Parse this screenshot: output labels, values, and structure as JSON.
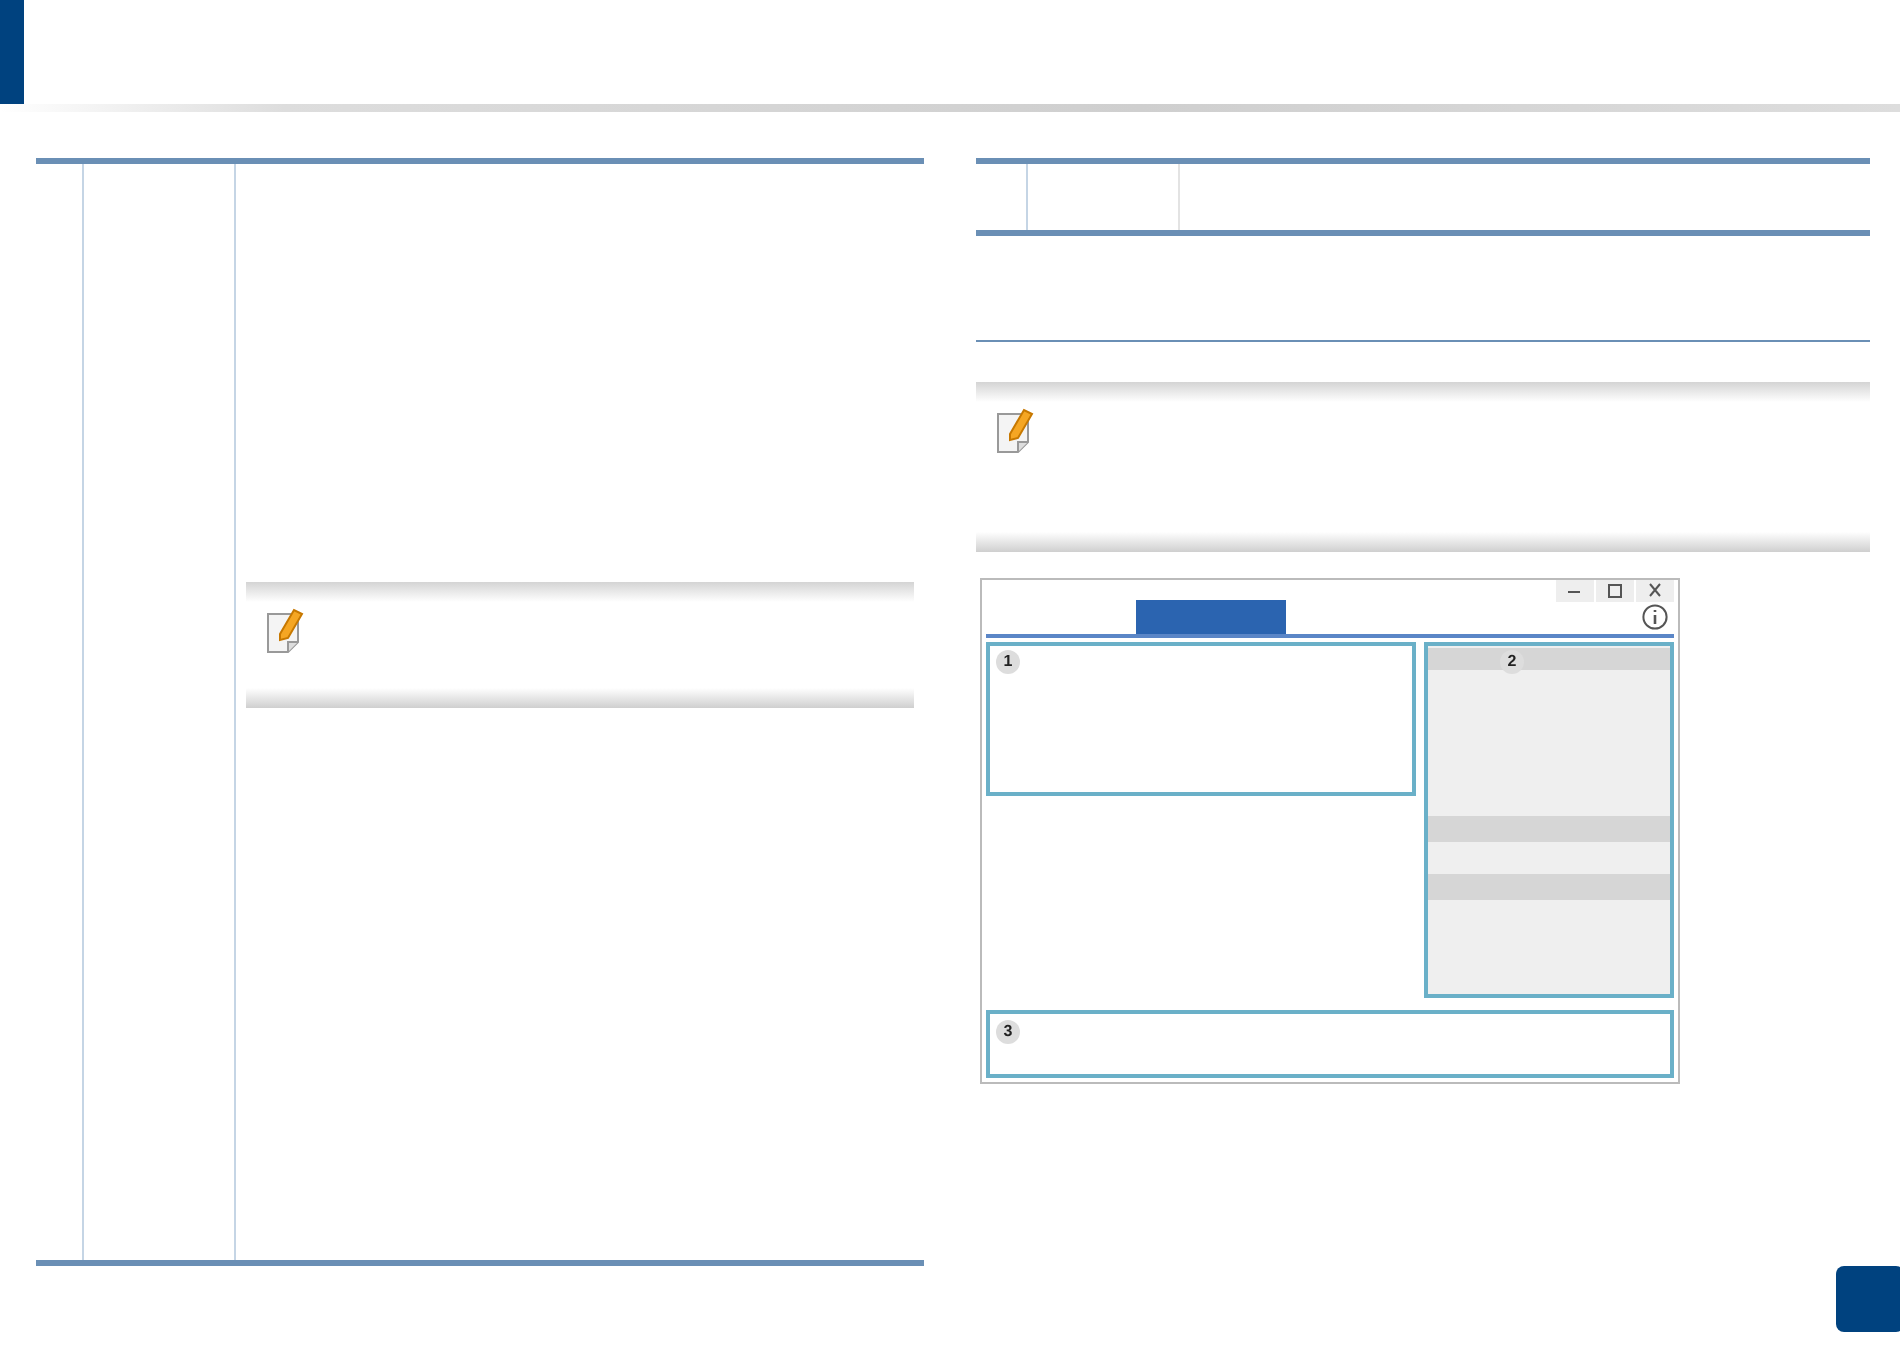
{
  "screenshot": {
    "tabs": [
      {
        "selected": true
      }
    ],
    "panels": [
      {
        "number": "1"
      },
      {
        "number": "2"
      },
      {
        "number": "3"
      }
    ]
  }
}
